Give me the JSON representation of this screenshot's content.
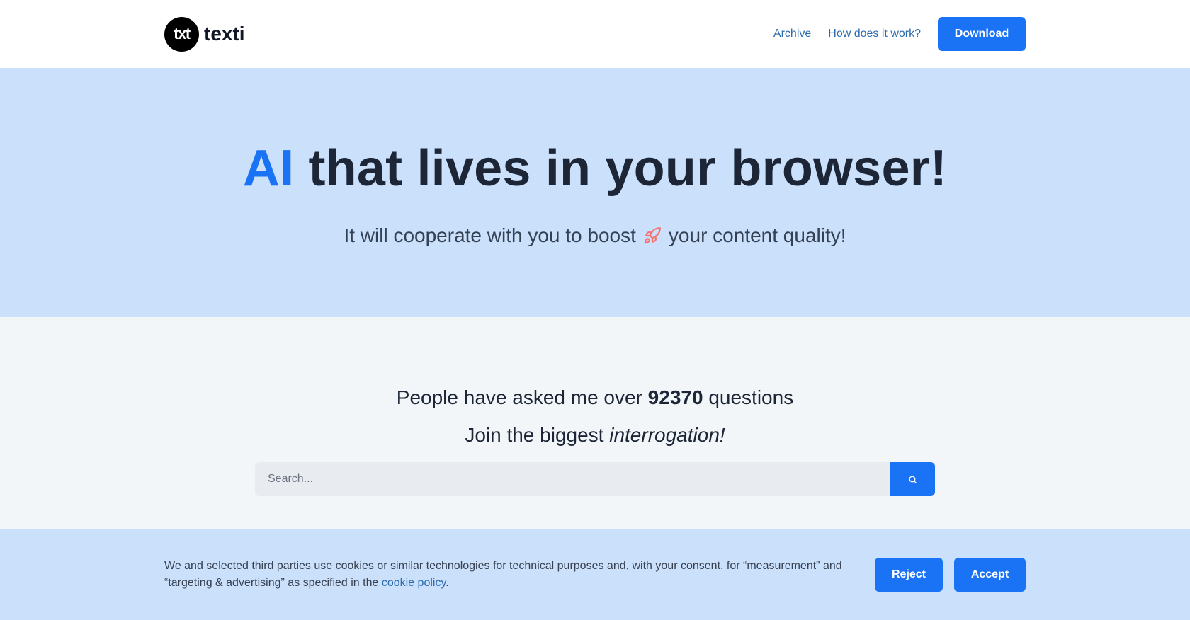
{
  "header": {
    "logo_text": "txt",
    "brand_name": "texti",
    "nav": [
      {
        "label": "Archive"
      },
      {
        "label": "How does it work?"
      }
    ],
    "download_label": "Download"
  },
  "hero": {
    "title_accent": "AI",
    "title_rest": "that lives in your browser!",
    "subtitle_before": "It will cooperate with you to boost",
    "subtitle_after": "your content quality!"
  },
  "stats": {
    "line1_before": "People have asked me over",
    "count": "92370",
    "line1_after": "questions",
    "line2_before": "Join the biggest",
    "line2_emph": "interrogation!"
  },
  "search": {
    "placeholder": "Search..."
  },
  "cookie": {
    "text_before": "We and selected third parties use cookies or similar technologies for technical purposes and, with your consent, for “measurement” and “targeting & advertising” as specified in the",
    "link_label": "cookie policy",
    "text_after": ".",
    "reject_label": "Reject",
    "accept_label": "Accept"
  },
  "colors": {
    "accent": "#1a73f5",
    "hero_bg": "#cbe0fb",
    "stats_bg": "#f3f6f9",
    "rocket": "#f87171"
  },
  "icons": {
    "rocket": "rocket-icon",
    "search": "search-icon"
  }
}
